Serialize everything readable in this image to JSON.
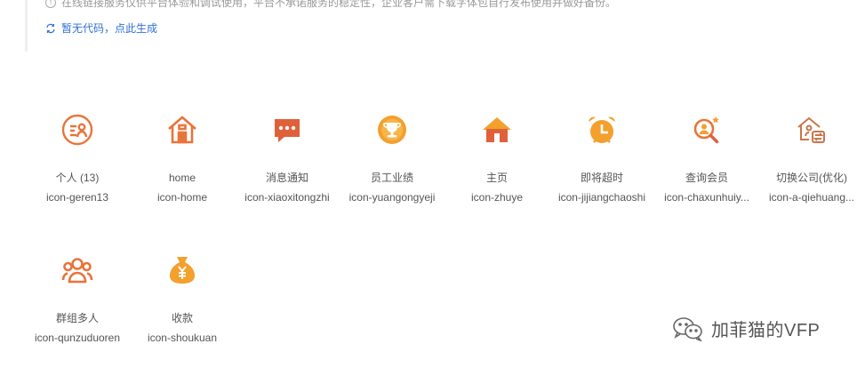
{
  "notice": {
    "text": "在线链接服务仅供平台体验和调试使用，平台不承诺服务的稳定性，企业客户需下载字体包自行发布使用并做好备份。",
    "generate_link": "暂无代码，点此生成"
  },
  "colors": {
    "accent": "#e8743b",
    "link": "#2f6fd6",
    "gold": "#f3a02d"
  },
  "icons": [
    {
      "label": "个人 (13)",
      "code": "icon-geren13",
      "icon": "person-card-icon"
    },
    {
      "label": "home",
      "code": "icon-home",
      "icon": "house-icon"
    },
    {
      "label": "消息通知",
      "code": "icon-xiaoxitongzhi",
      "icon": "chat-bubble-icon"
    },
    {
      "label": "员工业绩",
      "code": "icon-yuangongyeji",
      "icon": "trophy-icon"
    },
    {
      "label": "主页",
      "code": "icon-zhuye",
      "icon": "home-filled-icon"
    },
    {
      "label": "即将超时",
      "code": "icon-jijiangchaoshi",
      "icon": "alarm-clock-icon"
    },
    {
      "label": "查询会员",
      "code": "icon-chaxunhuiy...",
      "icon": "member-search-icon"
    },
    {
      "label": "切换公司(优化)",
      "code": "icon-a-qiehuang...",
      "icon": "switch-company-icon"
    },
    {
      "label": "群组多人",
      "code": "icon-qunzuduoren",
      "icon": "group-icon"
    },
    {
      "label": "收款",
      "code": "icon-shoukuan",
      "icon": "money-bag-icon"
    }
  ],
  "watermark": {
    "text": "加菲猫的VFP"
  }
}
